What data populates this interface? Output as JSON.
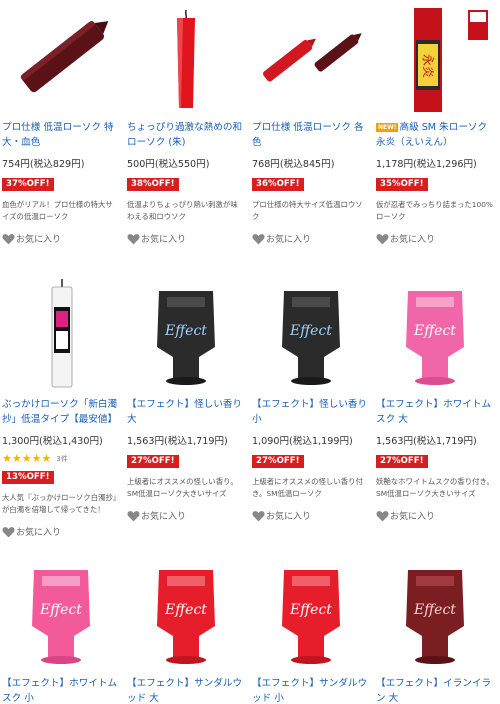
{
  "products": [
    {
      "title": "プロ仕様 低温ローソク 特大・血色",
      "price": "754円(税込829円)",
      "off": "37%OFF!",
      "desc": "血色がリアル！プロ仕様の特大サイズの低温ローソク",
      "fav": "お気に入り",
      "image": "dark-red-large-candle"
    },
    {
      "title": "ちょっぴり過激な熱めの和ローソク (朱)",
      "price": "500円(税込550円)",
      "off": "38%OFF!",
      "desc": "低温よりちょっぴり熱い刺激が味わえる和ロウソク",
      "fav": "お気に入り",
      "image": "red-japanese-candle"
    },
    {
      "title": "プロ仕様 低温ローソク 各色",
      "price": "768円(税込845円)",
      "off": "36%OFF!",
      "desc": "プロ仕様の特大サイズ低温ロウソク",
      "fav": "お気に入り",
      "image": "two-candles-red-dark"
    },
    {
      "new_badge": "NEW!",
      "title": "高級 SM 朱ローソク 永炎（えいえん）",
      "price": "1,178円(税込1,296円)",
      "off": "35%OFF!",
      "desc": "仮が忍者でみっちり詰まった100%ローソク",
      "fav": "お気に入り",
      "image": "eien-candle-package",
      "package_text": "永炎"
    },
    {
      "title": "ぶっかけローソク「新白濁抄」低温タイプ【最安値】",
      "price": "1,300円(税込1,430円)",
      "rating_count": "3件",
      "off": "13%OFF!",
      "desc": "大人気『ぶっかけローソク白濁抄』が白濁を倍増して帰ってきた！",
      "fav": "お気に入り",
      "image": "white-candle-label"
    },
    {
      "title": "【エフェクト】怪しい香り 大",
      "price": "1,563円(税込1,719円)",
      "off": "27%OFF!",
      "desc": "上級者にオススメの怪しい香り。SM低温ローソク大きいサイズ",
      "fav": "お気に入り",
      "image": "effect-black-large",
      "package_text": "Effect"
    },
    {
      "title": "【エフェクト】怪しい香り 小",
      "price": "1,090円(税込1,199円)",
      "off": "27%OFF!",
      "desc": "上級者にオススメの怪しい香り付き。SM低温ローソク",
      "fav": "お気に入り",
      "image": "effect-black-small",
      "package_text": "Effect"
    },
    {
      "title": "【エフェクト】ホワイトムスク 大",
      "price": "1,563円(税込1,719円)",
      "off": "27%OFF!",
      "desc": "妖艶なホワイトムスクの香り付き。SM低温ローソク大きいサイズ",
      "fav": "お気に入り",
      "image": "effect-pink-large",
      "package_text": "Effect"
    },
    {
      "title": "【エフェクト】ホワイトムスク 小",
      "image": "effect-pink-small",
      "package_text": "Effect"
    },
    {
      "title": "【エフェクト】サンダルウッド 大",
      "image": "effect-red-large",
      "package_text": "Effect"
    },
    {
      "title": "【エフェクト】サンダルウッド 小",
      "image": "effect-red-small",
      "package_text": "Effect"
    },
    {
      "title": "【エフェクト】イランイラン 大",
      "image": "effect-darkred-large",
      "package_text": "Effect"
    }
  ],
  "colors": {
    "link": "#1a5fb4",
    "off_badge": "#d61f1f",
    "star": "#f4b400"
  }
}
